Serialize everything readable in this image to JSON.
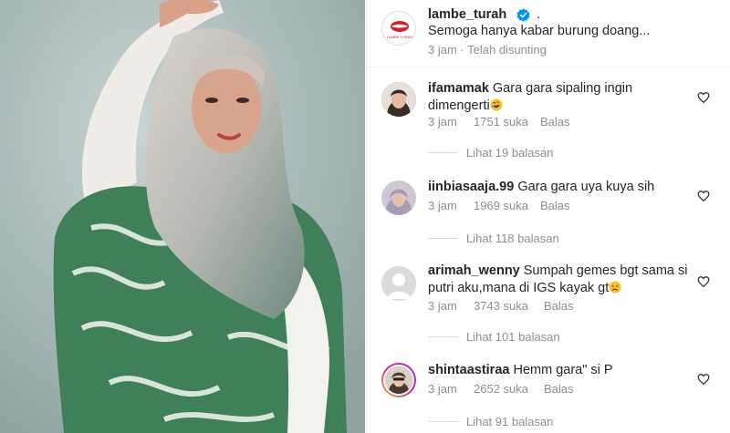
{
  "post": {
    "author": "lambe_turah",
    "avatar_logo_text": "LAMBE TURAH",
    "caption_suffix": ".",
    "caption": "Semoga hanya kabar burung doang...",
    "time": "3 jam",
    "edited": "Telah disunting"
  },
  "comments": [
    {
      "username": "ifamamak",
      "text": "Gara gara sipaling ingin dimengerti",
      "emoji": "rolling-laughing-emoji",
      "time": "3 jam",
      "likes": "1751 suka",
      "reply": "Balas",
      "view_replies": "Lihat 19 balasan",
      "avatar": "photo"
    },
    {
      "username": "iinbiasaaja.99",
      "text": "Gara gara uya kuya sih",
      "time": "3 jam",
      "likes": "1969 suka",
      "reply": "Balas",
      "view_replies": "Lihat 118 balasan",
      "avatar": "photo"
    },
    {
      "username": "arimah_wenny",
      "text": "Sumpah gemes bgt sama si putri aku,mana di IGS kayak gt",
      "emoji": "sad-face-emoji",
      "time": "3 jam",
      "likes": "3743 suka",
      "reply": "Balas",
      "view_replies": "Lihat 101 balasan",
      "avatar": "default"
    },
    {
      "username": "shintaastiraa",
      "text": "Hemm gara\" si P",
      "time": "3 jam",
      "likes": "2652 suka",
      "reply": "Balas",
      "view_replies": "Lihat 91 balasan",
      "avatar": "story-ring"
    }
  ],
  "colors": {
    "text": "#262626",
    "secondary": "#8e8e8e",
    "verified": "#0095f6",
    "brand_red": "#d4202c",
    "story_ring": "#d6249f"
  }
}
